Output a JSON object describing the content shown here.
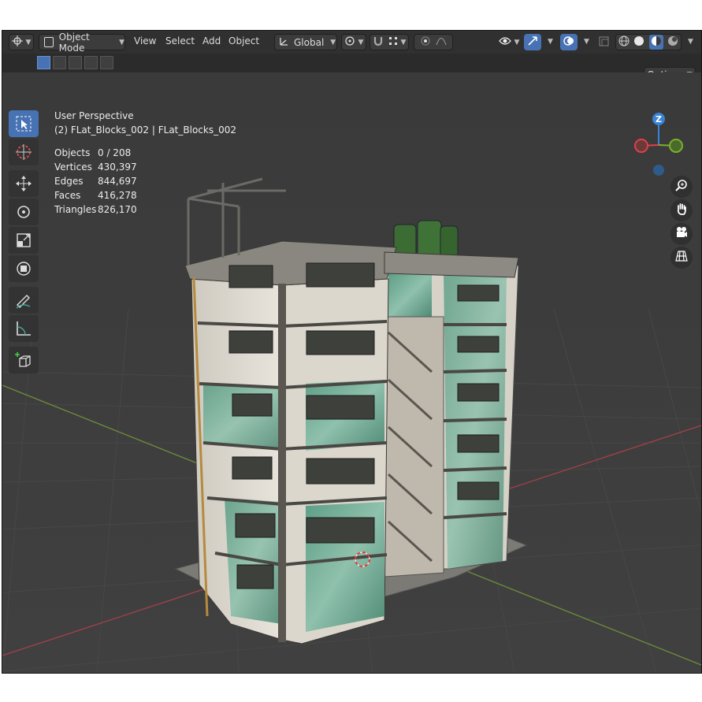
{
  "header": {
    "editor_type_icon": "crosshair-editor-icon",
    "mode_label": "Object Mode",
    "menus": [
      "View",
      "Select",
      "Add",
      "Object"
    ],
    "transform_orientation": "Global",
    "options_label": "Options"
  },
  "viewport": {
    "perspective_label": "User Perspective",
    "selection_label": "(2) FLat_Blocks_002 | FLat_Blocks_002",
    "stats": [
      {
        "key": "Objects",
        "value": "0 / 208"
      },
      {
        "key": "Vertices",
        "value": "430,397"
      },
      {
        "key": "Edges",
        "value": "844,697"
      },
      {
        "key": "Faces",
        "value": "416,278"
      },
      {
        "key": "Triangles",
        "value": "826,170"
      }
    ]
  },
  "gizmo": {
    "z_label": "Z"
  },
  "colors": {
    "accent": "#4772b3",
    "axis_x": "#e0404a",
    "axis_y": "#7cb02c",
    "axis_z": "#3a84d6"
  },
  "tools": [
    "select-box-icon",
    "cursor-icon",
    "move-icon",
    "rotate-icon",
    "scale-icon",
    "transform-icon",
    "annotate-icon",
    "measure-icon",
    "add-cube-icon"
  ]
}
